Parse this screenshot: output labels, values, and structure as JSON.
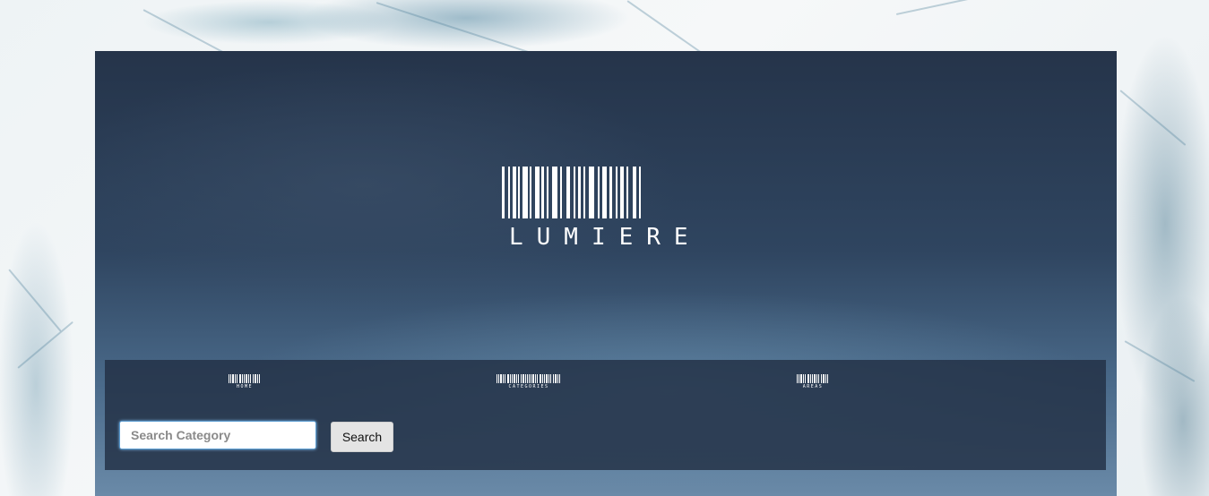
{
  "brand": {
    "logo_icon": "barcode-logo-icon",
    "name": "LUMIERE"
  },
  "nav": {
    "items": [
      {
        "label": "HOME",
        "icon": "barcode-icon"
      },
      {
        "label": "CATEGORIES",
        "icon": "barcode-icon"
      },
      {
        "label": "AREAS",
        "icon": "barcode-icon"
      }
    ]
  },
  "search": {
    "placeholder": "Search Category",
    "value": "",
    "button_label": "Search"
  },
  "colors": {
    "panel": "#222f44",
    "hero_top": "#25344a",
    "accent_focus": "#5a9bd0",
    "button_bg": "#e4e4e4"
  }
}
